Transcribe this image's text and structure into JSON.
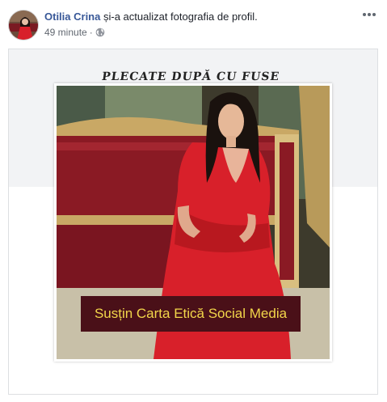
{
  "post": {
    "author_name": "Otilia Crina",
    "action_text": " și-a actualizat fotografia de profil.",
    "timestamp": "49 minute",
    "separator": "·",
    "privacy_icon": "globe-icon",
    "more_icon": "more-options-icon",
    "cover_text": "PLECATE DUPĂ CU FUSE",
    "profile_photo_caption": "Susțin Carta Etică Social Media"
  },
  "colors": {
    "author_link": "#385898",
    "meta_text": "#616770",
    "banner_bg": "#4a1018",
    "banner_text": "#f2d64a",
    "dress_red": "#d8202a"
  }
}
